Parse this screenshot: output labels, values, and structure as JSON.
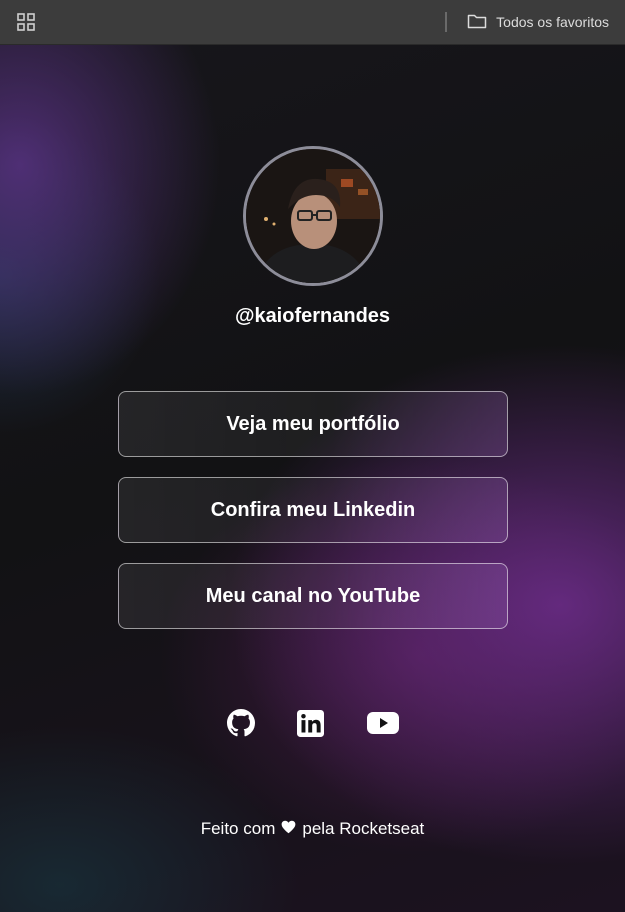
{
  "bookmarks_bar": {
    "apps_icon": "apps-grid-icon",
    "folder_icon": "folder-icon",
    "all_bookmarks_label": "Todos os favoritos",
    "background": "#3c3c3c"
  },
  "profile": {
    "handle": "@kaiofernandes",
    "avatar_border": "#8d8d99"
  },
  "links": [
    {
      "label": "Veja meu portfólio"
    },
    {
      "label": "Confira meu Linkedin"
    },
    {
      "label": "Meu canal no YouTube"
    }
  ],
  "social": [
    {
      "icon": "github-icon"
    },
    {
      "icon": "linkedin-icon"
    },
    {
      "icon": "youtube-icon"
    }
  ],
  "footer": {
    "prefix": "Feito com",
    "heart_icon": "heart-icon",
    "suffix": "pela Rocketseat"
  },
  "colors": {
    "background": "#121214",
    "accent_purple": "#6e2d8c",
    "text": "#ffffff"
  }
}
